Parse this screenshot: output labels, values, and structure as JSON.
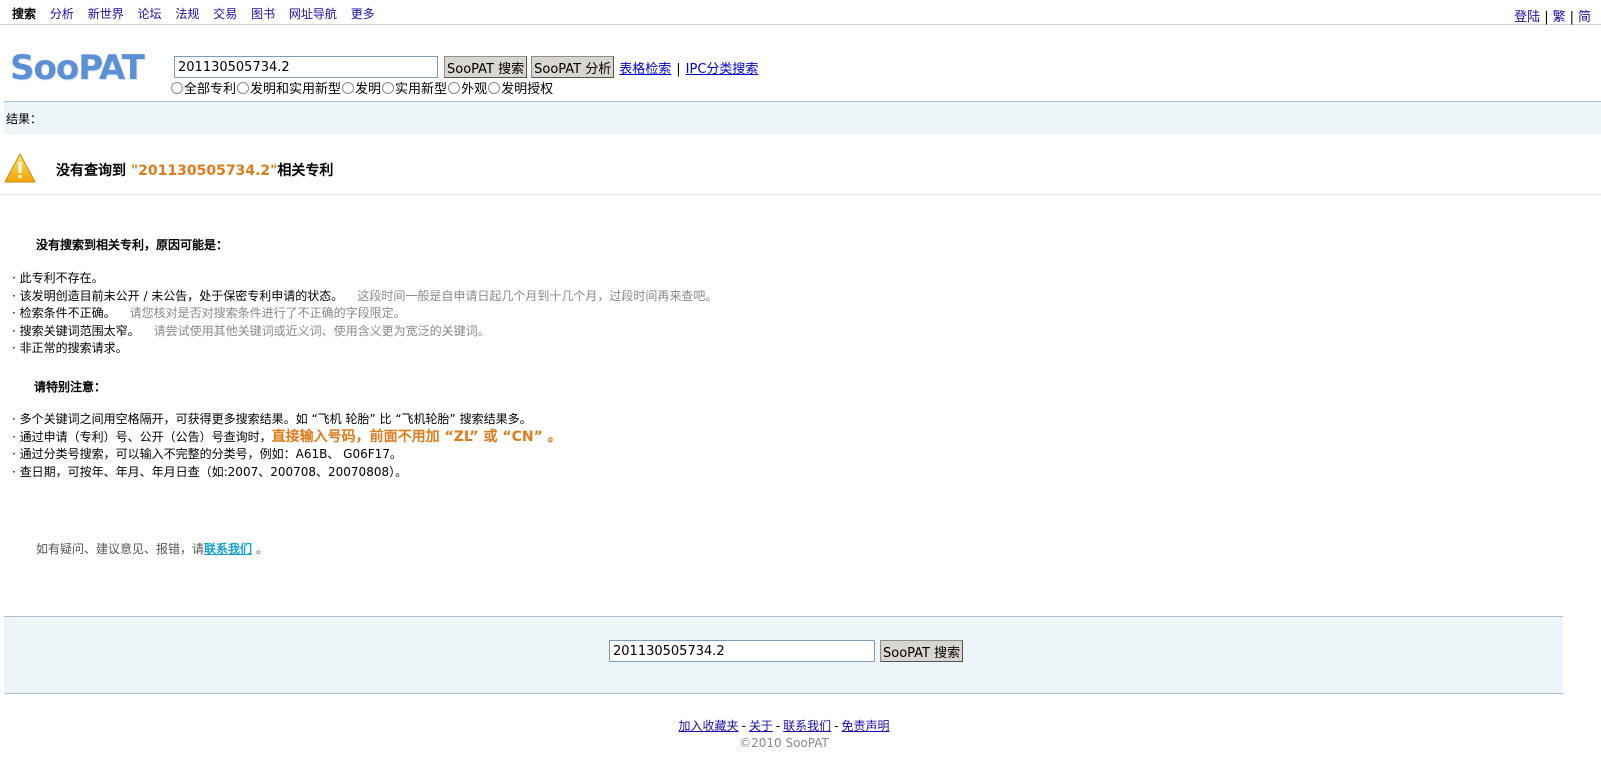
{
  "nav": {
    "items": [
      "搜索",
      "分析",
      "新世界",
      "论坛",
      "法规",
      "交易",
      "图书",
      "网址导航",
      "更多"
    ],
    "right": [
      "登陆",
      "繁",
      "简"
    ]
  },
  "header": {
    "logo": "SooPAT",
    "query": "201130505734.2",
    "search_button": "SooPAT 搜索",
    "analysis_button": "SooPAT 分析",
    "table_search_link": "表格检索",
    "ipc_link": "IPC分类搜索",
    "radios": [
      "全部专利",
      "发明和实用新型",
      "发明",
      "实用新型",
      "外观",
      "发明授权"
    ]
  },
  "results": {
    "label": "结果：",
    "notice_prefix": "没有查询到",
    "notice_query": "\"201130505734.2\"",
    "notice_suffix": "相关专利"
  },
  "reasons": {
    "title": "没有搜索到相关专利，原因可能是：",
    "items": [
      {
        "text": "· 此专利不存在。",
        "hint": ""
      },
      {
        "text": "· 该发明创造目前未公开 / 未公告，处于保密专利申请的状态。",
        "hint": "这段时间一般是自申请日起几个月到十几个月，过段时间再来查吧。"
      },
      {
        "text": "· 检索条件不正确。",
        "hint": "请您核对是否对搜索条件进行了不正确的字段限定。"
      },
      {
        "text": "· 搜索关键词范围太窄。",
        "hint": "请尝试使用其他关键词或近义词、使用含义更为宽泛的关键词。"
      },
      {
        "text": "· 非正常的搜索请求。",
        "hint": ""
      }
    ]
  },
  "notes": {
    "title": "请特别注意：",
    "line1": "· 多个关键词之间用空格隔开，可获得更多搜索结果。如 “飞机 轮胎” 比 “飞机轮胎” 搜索结果多。",
    "line2_prefix": "· 通过申请（专利）号、公开（公告）号查询时，",
    "line2_emph": "直接输入号码，前面不用加 “ZL” 或 “CN” 。",
    "line3": "· 通过分类号搜索，可以输入不完整的分类号，例如：A61B、 G06F17。",
    "line4": "· 查日期，可按年、年月、年月日查（如:2007、200708、20070808）。"
  },
  "contact": {
    "prefix": "如有疑问、建议意见、报错，请",
    "link": "联系我们",
    "suffix": " 。"
  },
  "bottom_search": {
    "query": "201130505734.2",
    "button": "SooPAT 搜索"
  },
  "footer": {
    "links": [
      "加入收藏夹",
      "关于",
      "联系我们",
      "免责声明"
    ],
    "copyright": "©2010 SooPAT"
  }
}
